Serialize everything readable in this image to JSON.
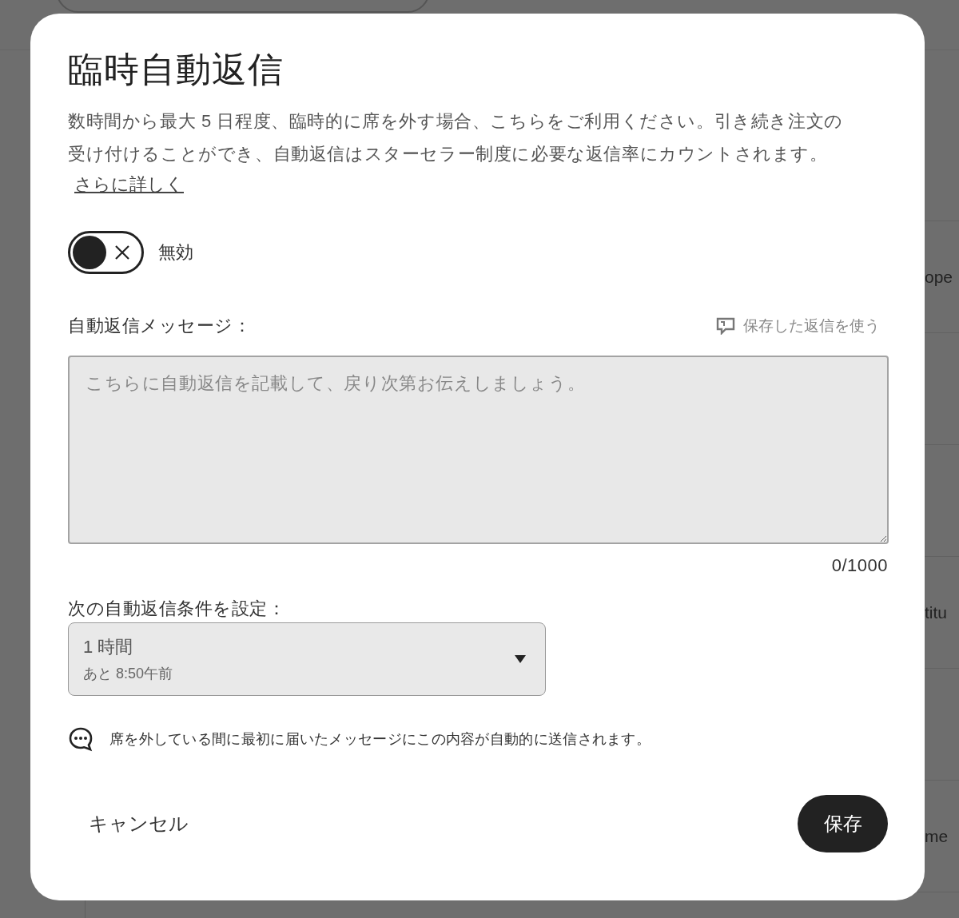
{
  "backdrop": {
    "texts": [
      "ope",
      "titu",
      "me"
    ]
  },
  "dialog": {
    "title": "臨時自動返信",
    "description": "数時間から最大 5 日程度、臨時的に席を外す場合、こちらをご利用ください。引き続き注文の受け付けることができ、自動返信はスターセラー制度に必要な返信率にカウントされます。",
    "learn_more_link": "さらに詳しく",
    "toggle": {
      "on": false,
      "label": "無効"
    },
    "message": {
      "label": "自動返信メッセージ：",
      "saved_replies_link": "保存した返信を使う",
      "placeholder": "こちらに自動返信を記載して、戻り次第お伝えしましょう。",
      "counter": "0/1000"
    },
    "duration": {
      "label": "次の自動返信条件を設定：",
      "value": "1 時間",
      "detail": "あと 8:50午前"
    },
    "note": "席を外している間に最初に届いたメッセージにこの内容が自動的に送信されます。",
    "buttons": {
      "cancel": "キャンセル",
      "save": "保存"
    }
  }
}
